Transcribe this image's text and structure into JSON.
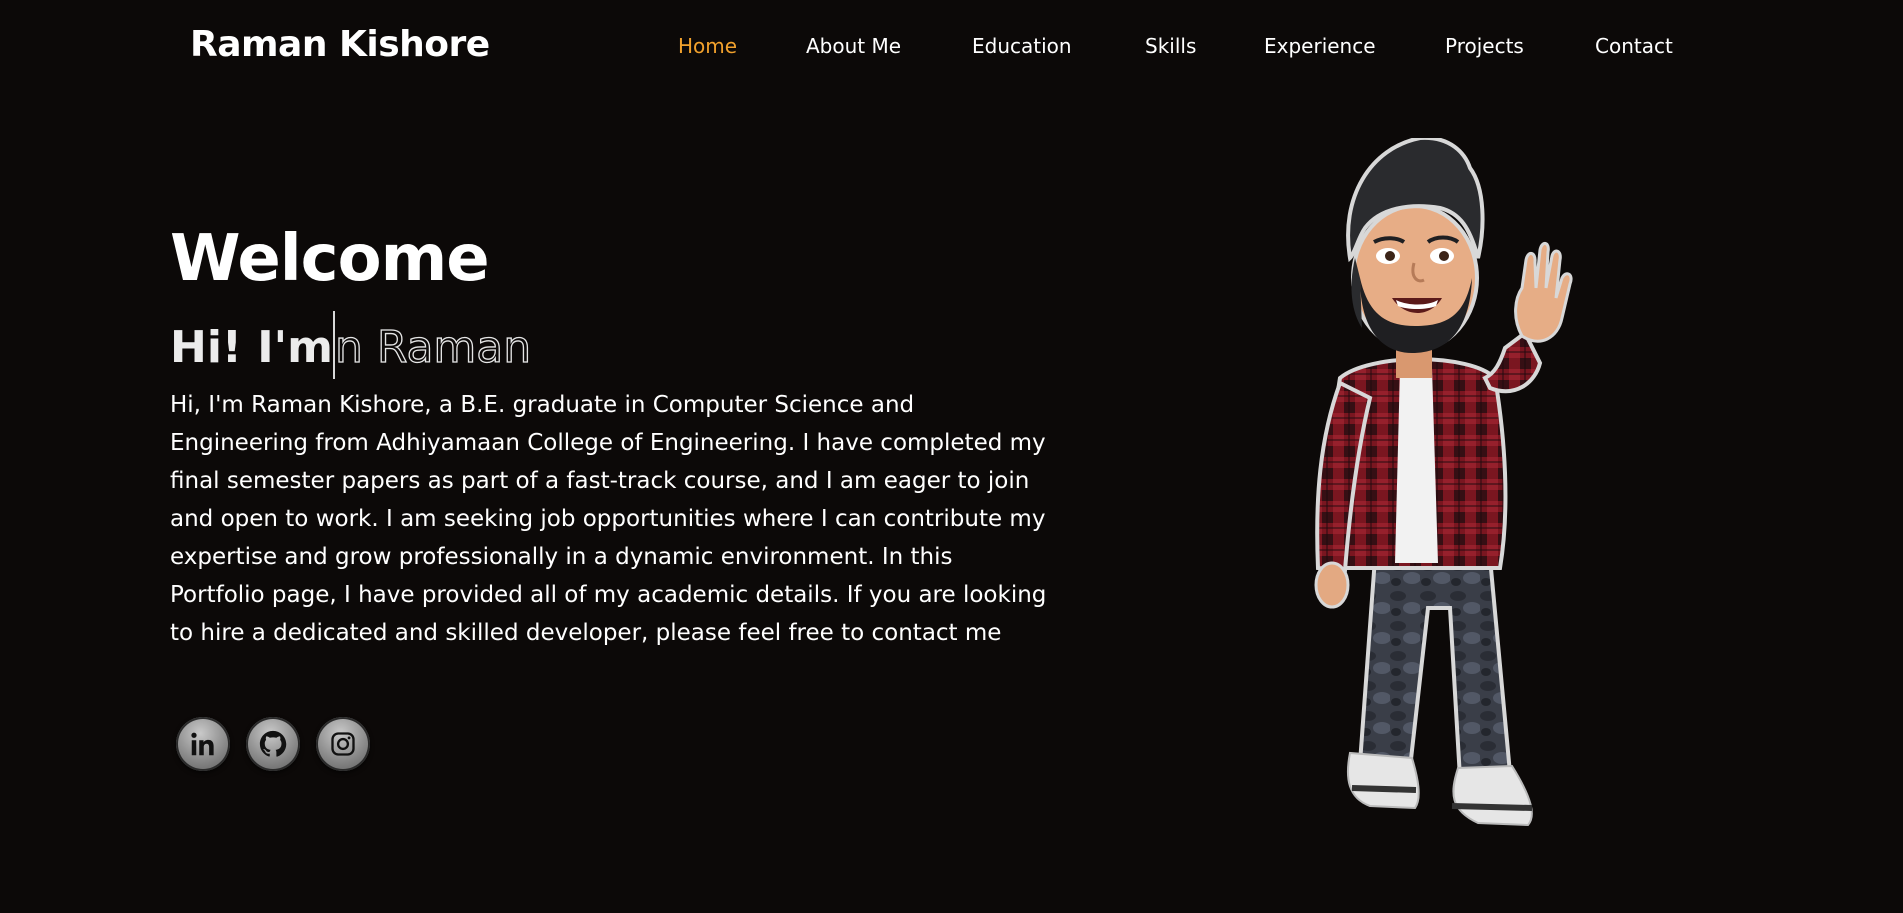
{
  "header": {
    "brand": "Raman Kishore",
    "nav": [
      {
        "label": "Home",
        "active": true
      },
      {
        "label": "About Me"
      },
      {
        "label": "Education"
      },
      {
        "label": "Skills"
      },
      {
        "label": "Experience"
      },
      {
        "label": "Projects"
      },
      {
        "label": "Contact"
      }
    ]
  },
  "hero": {
    "welcome": "Welcome",
    "typed_solid": "Hi! I'm",
    "typed_outline": "n Raman",
    "intro": "Hi, I'm Raman Kishore, a B.E. graduate in Computer Science and Engineering from Adhiyamaan College of Engineering. I have completed my final semester papers as part of a fast-track course, and I am eager to join and open to work. I am seeking job opportunities where I can contribute my expertise and grow professionally in a dynamic environment. In this Portfolio page, I have provided all of my academic details. If you are looking to hire a dedicated and skilled developer, please feel free to contact me"
  },
  "socials": [
    {
      "icon": "linkedin-icon"
    },
    {
      "icon": "github-icon"
    },
    {
      "icon": "instagram-icon"
    }
  ],
  "colors": {
    "background": "#0c0908",
    "accent": "#f2a12c",
    "text": "#ffffff"
  }
}
